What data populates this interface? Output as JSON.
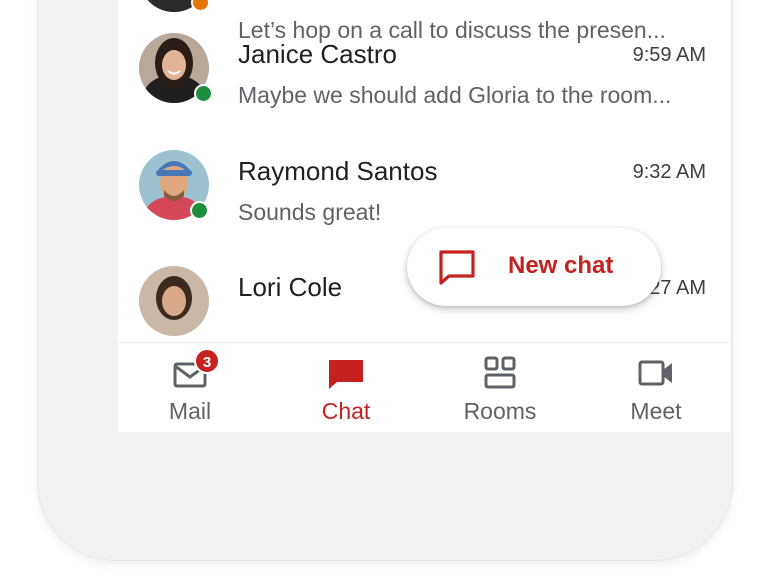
{
  "colors": {
    "accent": "#c5221f",
    "presence_online": "#1e8e3e",
    "presence_away": "#e37400",
    "text_primary": "#202124",
    "text_secondary": "#5f6368"
  },
  "conversations": [
    {
      "name": "",
      "time": "",
      "preview": "Let’s hop on a call to discuss the presen...",
      "presence": "away",
      "avatar_icon": "user-avatar"
    },
    {
      "name": "Janice Castro",
      "time": "9:59 AM",
      "preview": "Maybe we should add Gloria to the room...",
      "presence": "online",
      "avatar_icon": "user-avatar"
    },
    {
      "name": "Raymond Santos",
      "time": "9:32 AM",
      "preview": "Sounds great!",
      "presence": "online",
      "avatar_icon": "user-avatar"
    },
    {
      "name": "Lori Cole",
      "time": "9:27 AM",
      "preview": "",
      "presence": "",
      "avatar_icon": "user-avatar"
    }
  ],
  "fab": {
    "label": "New chat",
    "icon": "chat-bubble-outline-icon"
  },
  "bottom_nav": {
    "items": [
      {
        "label": "Mail",
        "icon": "mail-icon",
        "badge": "3",
        "active": false
      },
      {
        "label": "Chat",
        "icon": "chat-icon",
        "active": true
      },
      {
        "label": "Rooms",
        "icon": "rooms-icon",
        "active": false
      },
      {
        "label": "Meet",
        "icon": "video-camera-icon",
        "active": false
      }
    ]
  }
}
